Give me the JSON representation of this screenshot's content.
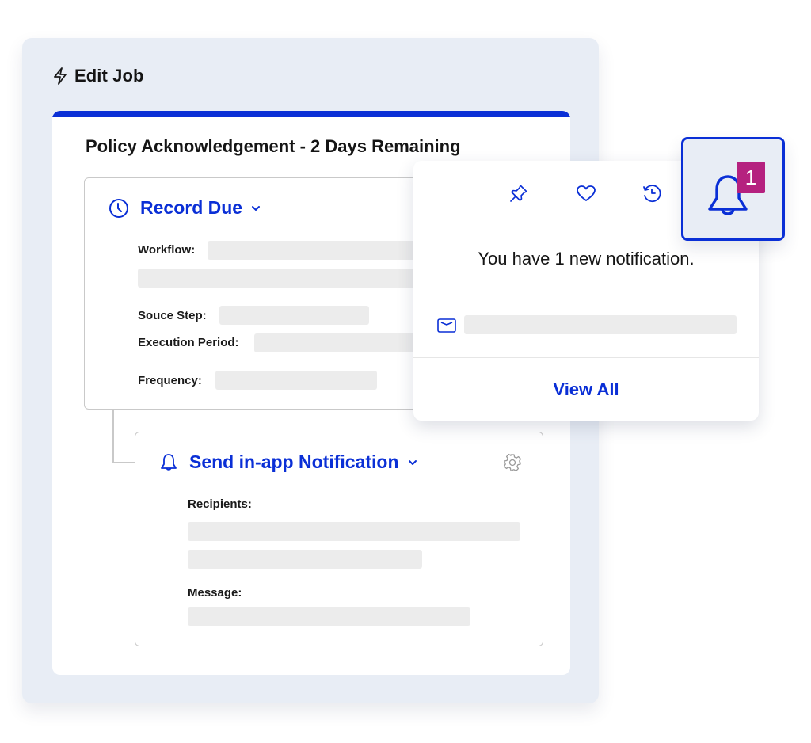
{
  "header": {
    "title": "Edit Job",
    "icon": "lightning-icon"
  },
  "job": {
    "title": "Policy Acknowledgement - 2 Days Remaining",
    "accent_color": "#0a2fd6"
  },
  "record_step": {
    "icon": "clock-icon",
    "title": "Record Due",
    "fields": [
      {
        "label": "Workflow:"
      },
      {
        "label": "Souce Step:"
      },
      {
        "label": "Execution Period:"
      },
      {
        "label": "Frequency:"
      }
    ]
  },
  "notify_step": {
    "icon": "bell-icon",
    "title": "Send in-app Notification",
    "fields": [
      {
        "label": "Recipients:"
      },
      {
        "label": "Message:"
      }
    ]
  },
  "notifications": {
    "toolbar": [
      "pin-icon",
      "heart-icon",
      "history-icon"
    ],
    "message": "You have 1 new notification.",
    "items": [
      {
        "icon": "envelope-icon"
      }
    ],
    "view_all_label": "View All"
  },
  "bell_button": {
    "badge_count": "1",
    "badge_color": "#b5217f"
  }
}
